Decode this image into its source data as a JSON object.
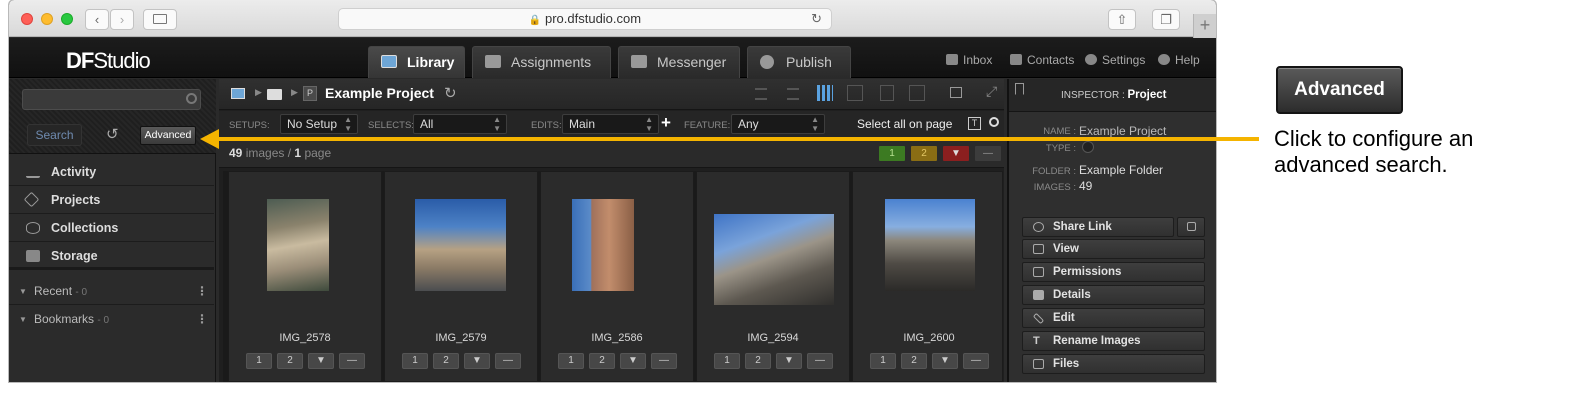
{
  "browser": {
    "url": "pro.dfstudio.com"
  },
  "app": {
    "logo_df": "DF",
    "logo_studio": "Studio",
    "tabs": [
      {
        "label": "Library",
        "active": true
      },
      {
        "label": "Assignments",
        "active": false
      },
      {
        "label": "Messenger",
        "active": false
      },
      {
        "label": "Publish",
        "active": false
      }
    ],
    "top_links": [
      "Inbox",
      "Contacts",
      "Settings",
      "Help"
    ]
  },
  "sidebar": {
    "search_button": "Search",
    "advanced_button": "Advanced",
    "items": [
      "Activity",
      "Projects",
      "Collections",
      "Storage"
    ],
    "collections": [
      {
        "label": "Recent",
        "count": "- 0"
      },
      {
        "label": "Bookmarks",
        "count": "- 0"
      }
    ]
  },
  "center": {
    "breadcrumb_badge": "P",
    "project_name": "Example Project",
    "filters": {
      "setups_label": "SETUPS:",
      "setups_value": "No Setup",
      "selects_label": "SELECTS:",
      "selects_value": "All",
      "edits_label": "EDITS:",
      "edits_value": "Main",
      "feature_label": "FEATURE:",
      "feature_value": "Any",
      "select_all": "Select all on page"
    },
    "count": {
      "num": "49",
      "images_word": "images /",
      "pages": "1",
      "page_word": "page"
    },
    "flags": [
      "1",
      "2",
      "",
      "—"
    ],
    "images": [
      {
        "name": "IMG_2578"
      },
      {
        "name": "IMG_2579"
      },
      {
        "name": "IMG_2586"
      },
      {
        "name": "IMG_2594"
      },
      {
        "name": "IMG_2600"
      }
    ],
    "rating_buttons": [
      "1",
      "2",
      "",
      "—"
    ]
  },
  "inspector": {
    "title_prefix": "INSPECTOR :",
    "title_value": "Project",
    "name_label": "NAME :",
    "name_value": "Example Project",
    "type_label": "TYPE :",
    "folder_label": "FOLDER :",
    "folder_value": "Example Folder",
    "images_label": "IMAGES :",
    "images_value": "49",
    "actions": [
      "Share Link",
      "View",
      "Permissions",
      "Details",
      "Edit",
      "Rename Images",
      "Files"
    ]
  },
  "annotation": {
    "button_label": "Advanced",
    "text": "Click to configure an advanced search."
  },
  "colors": {
    "arrow": "#f5b400",
    "flag_green": "#3c7a22",
    "flag_yellow": "#8a6d14",
    "flag_red": "#8b1f1f"
  }
}
